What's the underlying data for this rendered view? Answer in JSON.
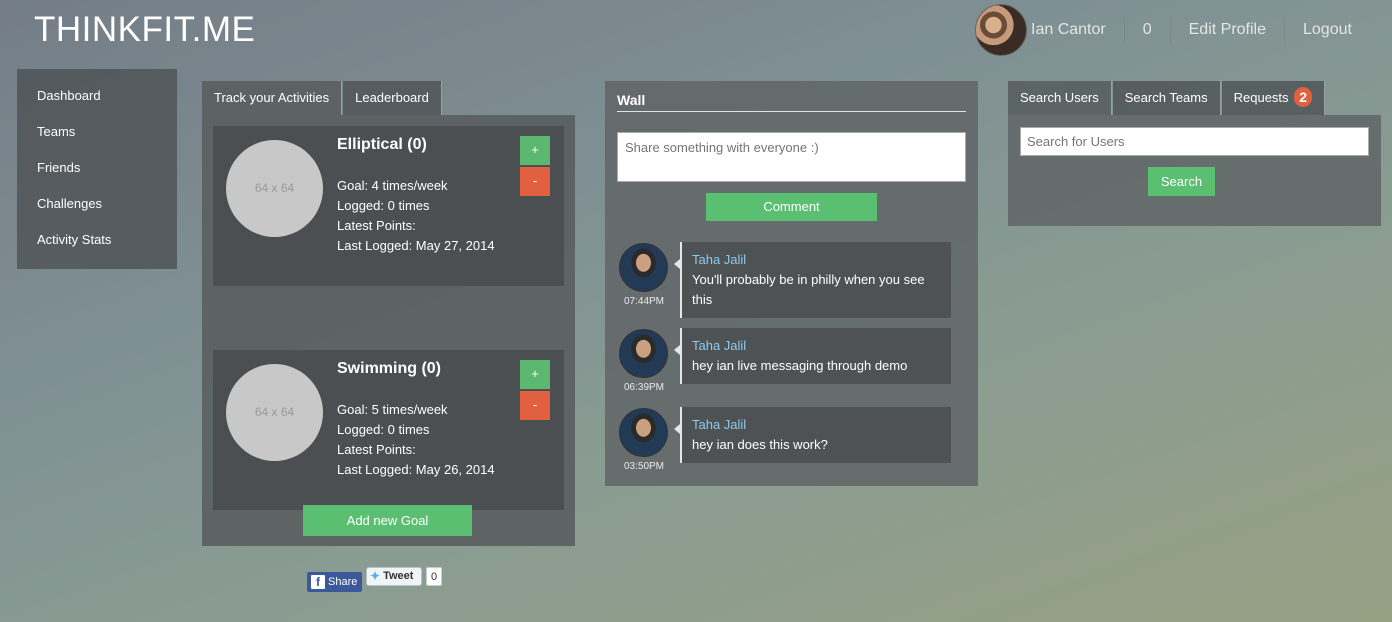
{
  "header": {
    "brand": "THINKFIT.ME",
    "user_name": "Ian Cantor",
    "count": "0",
    "edit_profile": "Edit Profile",
    "logout": "Logout"
  },
  "sidebar": {
    "items": [
      {
        "label": "Dashboard"
      },
      {
        "label": "Teams"
      },
      {
        "label": "Friends"
      },
      {
        "label": "Challenges"
      },
      {
        "label": "Activity Stats"
      }
    ]
  },
  "activity": {
    "tabs": [
      {
        "label": "Track your Activities"
      },
      {
        "label": "Leaderboard"
      }
    ],
    "cards": [
      {
        "placeholder": "64 x 64",
        "title": "Elliptical (0)",
        "goal": "Goal: 4 times/week",
        "logged": "Logged: 0 times",
        "latest_points": "Latest Points:",
        "last_logged": "Last Logged: May 27, 2014"
      },
      {
        "placeholder": "64 x 64",
        "title": "Swimming (0)",
        "goal": "Goal: 5 times/week",
        "logged": "Logged: 0 times",
        "latest_points": "Latest Points:",
        "last_logged": "Last Logged: May 26, 2014"
      }
    ],
    "plus_label": "+",
    "minus_label": "-",
    "add_goal": "Add new Goal"
  },
  "social": {
    "share": "Share",
    "tweet": "Tweet",
    "tweet_count": "0"
  },
  "wall": {
    "title": "Wall",
    "placeholder": "Share something with everyone :)",
    "comment_button": "Comment",
    "posts": [
      {
        "author": "Taha Jalil",
        "text": "You'll probably be in philly when you see this",
        "time": "07:44PM"
      },
      {
        "author": "Taha Jalil",
        "text": "hey ian live messaging through demo",
        "time": "06:39PM"
      },
      {
        "author": "Taha Jalil",
        "text": "hey ian does this work?",
        "time": "03:50PM"
      }
    ]
  },
  "search": {
    "tabs": [
      {
        "label": "Search Users"
      },
      {
        "label": "Search Teams"
      },
      {
        "label": "Requests"
      }
    ],
    "requests_badge": "2",
    "placeholder": "Search for Users",
    "button": "Search"
  },
  "colors": {
    "green": "#5bbf72",
    "red": "#e0603f",
    "link_blue": "#8ccaf2",
    "facebook": "#3b5998"
  }
}
